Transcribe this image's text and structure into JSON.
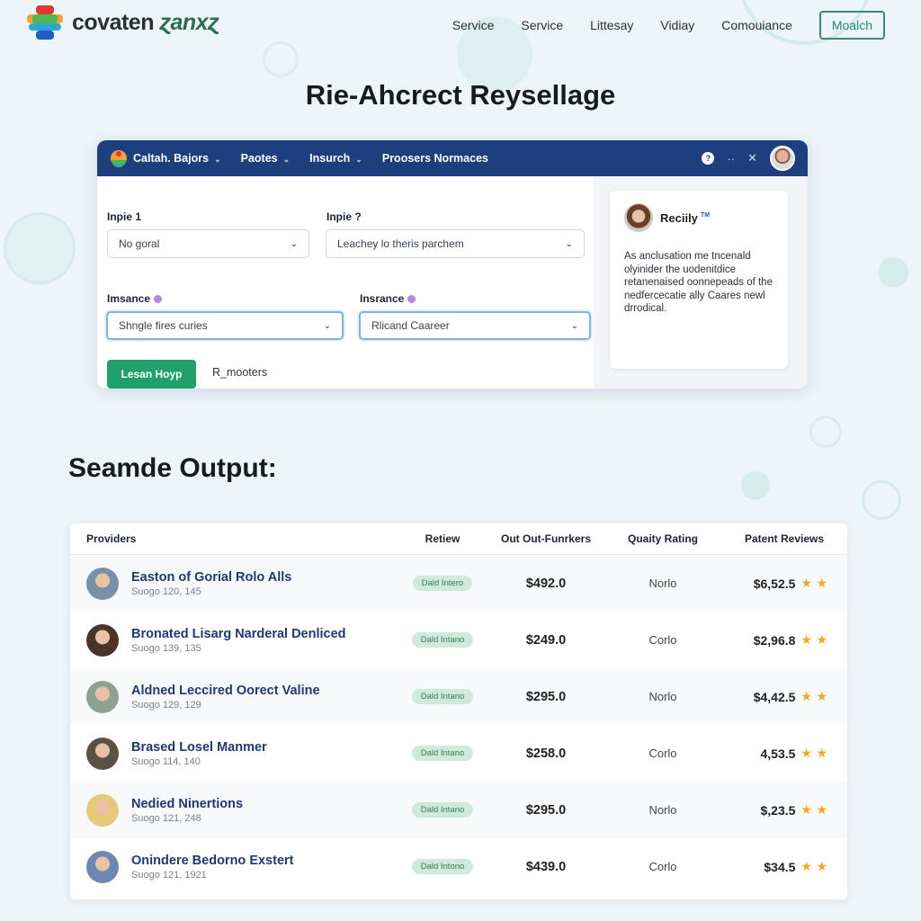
{
  "header": {
    "logo_text_main": "covaten",
    "logo_text_accent": "ɀanxɀ",
    "nav": [
      "Service",
      "Service",
      "Littesay",
      "Vidiay",
      "Comouiance"
    ],
    "cta_label": "Moalch"
  },
  "hero": {
    "title": "Rie-Ahcrect Reysellage"
  },
  "app": {
    "menu": [
      {
        "label": "Caltah. Bajors",
        "dropdown": true
      },
      {
        "label": "Paotes",
        "dropdown": true
      },
      {
        "label": "Insurch",
        "dropdown": true
      },
      {
        "label": "Proosers Normaces",
        "dropdown": false
      }
    ],
    "icons": {
      "help": "?",
      "more": "··",
      "close": "✕"
    },
    "form": {
      "input1_label": "Inpie 1",
      "input1_value": "No goral",
      "input2_label": "Inpie ?",
      "input2_value": "Leachey lo theris parchem",
      "insurance1_label": "Imsance",
      "insurance1_value": "Shngle fires curies",
      "insurance2_label": "Insrance",
      "insurance2_value": "Rlicand Caareer",
      "primary_button": "Lesan Hoyp",
      "secondary_link": "R_mooters"
    },
    "review": {
      "name": "Reciily",
      "badge": "TM",
      "body": "As anclusation me tncenald olyinider the uodenitdice retanenaised oonnepeads of the nedfercecatie ally Caares newl drrodical."
    }
  },
  "section_title": "Seamde Output:",
  "table": {
    "headers": [
      "Providers",
      "Retiew",
      "Out Out-Funrkers",
      "Quaity Rating",
      "Patent Reviews"
    ],
    "rows": [
      {
        "name": "Easton of Gorial Rolo Alls",
        "sub": "Suogo 120, 145",
        "badge": "Dald Intero",
        "price": "$492.0",
        "quality": "Norlo",
        "patent": "$6,52.5",
        "stars": 2,
        "avatar": "#7a8fa8"
      },
      {
        "name": "Bronated Lisarg Narderal Denliced",
        "sub": "Suogo 139, 135",
        "badge": "Dald Intano",
        "price": "$249.0",
        "quality": "Corlo",
        "patent": "$2,96.8",
        "stars": 2,
        "avatar": "#4a3328"
      },
      {
        "name": "Aldned Leccired Oorect Valine",
        "sub": "Suogo 129, 129",
        "badge": "Dald Intano",
        "price": "$295.0",
        "quality": "Norlo",
        "patent": "$4,42.5",
        "stars": 2,
        "avatar": "#8ea294"
      },
      {
        "name": "Brased Losel Manmer",
        "sub": "Suogo 114, 140",
        "badge": "Dald Intano",
        "price": "$258.0",
        "quality": "Corlo",
        "patent": "4,53.5",
        "stars": 2,
        "avatar": "#5a5146"
      },
      {
        "name": "Nedied Ninertions",
        "sub": "Suogo 121, 248",
        "badge": "Dald Intano",
        "price": "$295.0",
        "quality": "Norlo",
        "patent": "$,23.5",
        "stars": 2,
        "avatar": "#e9c77a"
      },
      {
        "name": "Onindere Bedorno Exstert",
        "sub": "Suogo 121, 1921",
        "badge": "Dald Intono",
        "price": "$439.0",
        "quality": "Corlo",
        "patent": "$34.5",
        "stars": 2,
        "avatar": "#6d87b3"
      }
    ]
  }
}
